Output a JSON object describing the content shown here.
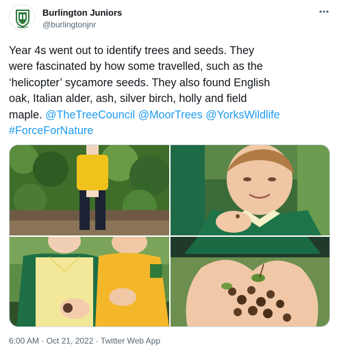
{
  "author": {
    "name": "Burlington Juniors",
    "handle": "@burlingtonjnr",
    "avatar_icon": "school-crest-icon"
  },
  "tweet": {
    "text_lines": [
      "Year 4s went out to identify trees and seeds. They",
      "were fascinated by how some travelled, such as the",
      "‘helicopter’ sycamore seeds. They also found English",
      "oak, Italian alder, ash, silver birch, holly and field",
      "maple."
    ],
    "mentions": [
      "@TheTreeCouncil",
      "@MoorTrees",
      "@YorksWildlife"
    ],
    "hashtag": "#ForceForNature"
  },
  "media": {
    "photos": [
      {
        "icon": "child-with-seeds-photo"
      },
      {
        "icon": "boy-holding-seed-photo"
      },
      {
        "icon": "two-children-photo"
      },
      {
        "icon": "hands-with-cones-photo"
      }
    ]
  },
  "footer": {
    "timestamp": "6:00 AM · Oct 21, 2022 · Twitter Web App"
  },
  "colors": {
    "link": "#1d9bf0",
    "text": "#0f1419",
    "muted": "#536471",
    "crest_green": "#2f7a3b"
  },
  "icons": {
    "more": "more-options-icon"
  }
}
